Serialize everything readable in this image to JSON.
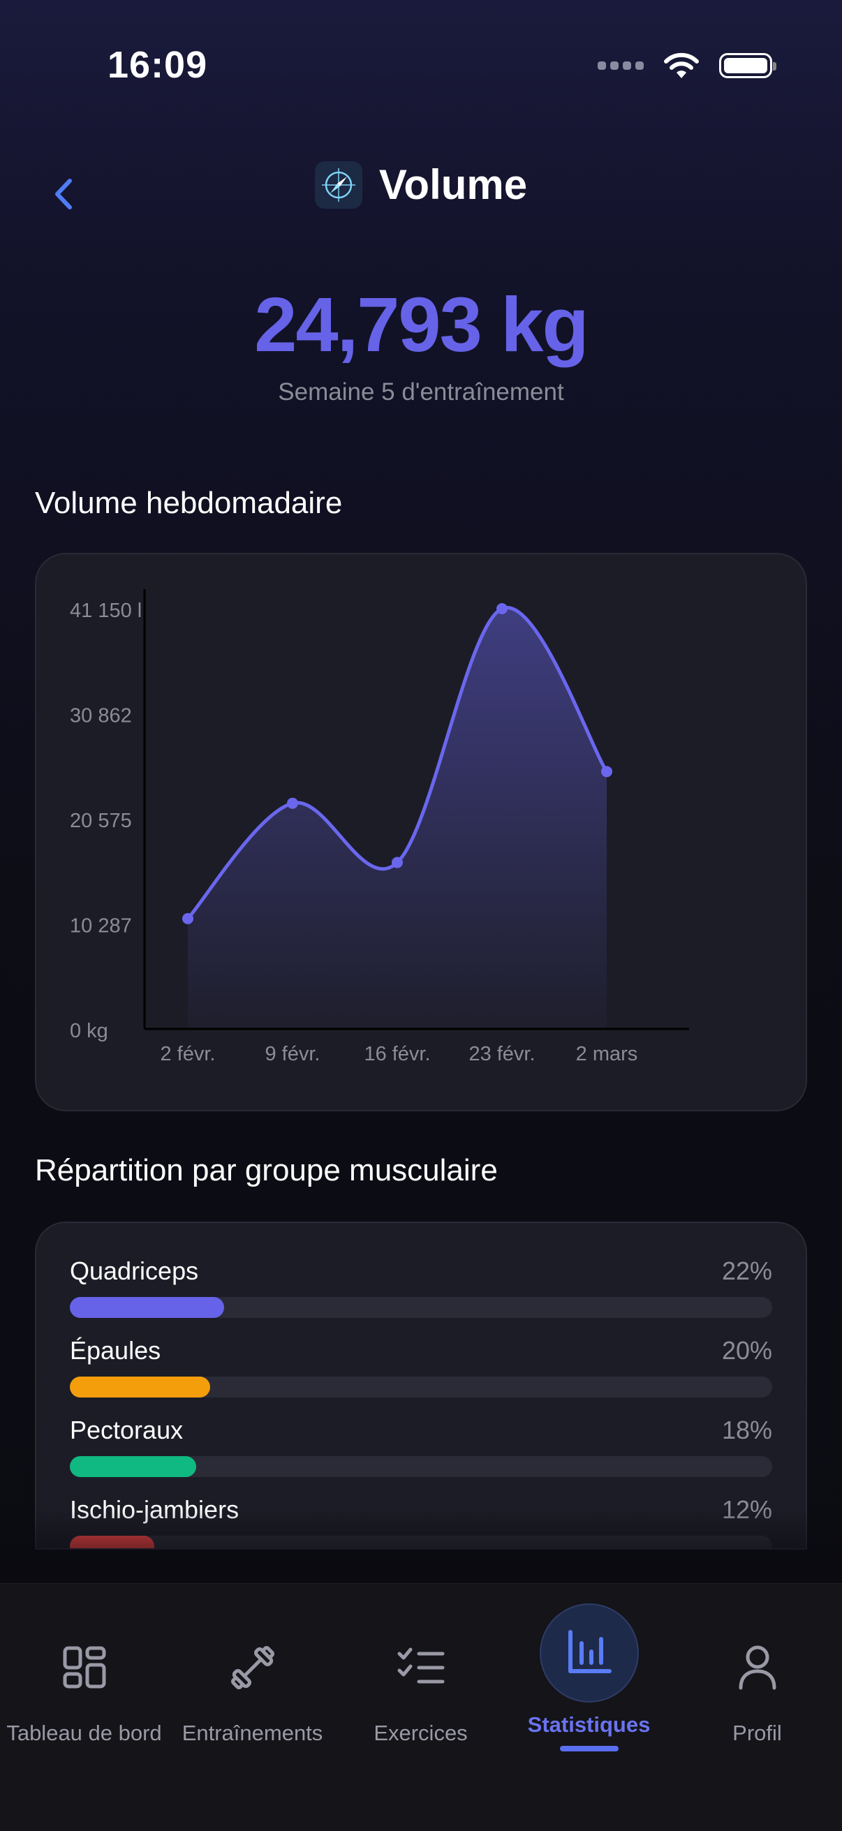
{
  "status": {
    "time": "16:09"
  },
  "header": {
    "title": "Volume",
    "icon": "compass-icon"
  },
  "summary": {
    "value": "24,793 kg",
    "subtitle": "Semaine 5 d'entraînement"
  },
  "weekly": {
    "section_title": "Volume hebdomadaire"
  },
  "chart_data": {
    "type": "area",
    "categories": [
      "2 févr.",
      "9 févr.",
      "16 févr.",
      "23 févr.",
      "2 mars"
    ],
    "values": [
      10800,
      22100,
      16300,
      41150,
      25200
    ],
    "y_ticks": [
      "0 kg",
      "10 287",
      "20 575",
      "30 862",
      "41 150 l"
    ],
    "ylim": [
      0,
      41150
    ],
    "grid": false,
    "color": "#6a67ee"
  },
  "muscles": {
    "section_title": "Répartition par groupe musculaire",
    "items": [
      {
        "label": "Quadriceps",
        "pct": "22%",
        "value": 0.22,
        "color": "#6663e8"
      },
      {
        "label": "Épaules",
        "pct": "20%",
        "value": 0.2,
        "color": "#f59e0b"
      },
      {
        "label": "Pectoraux",
        "pct": "18%",
        "value": 0.18,
        "color": "#10b981"
      },
      {
        "label": "Ischio-jambiers",
        "pct": "12%",
        "value": 0.12,
        "color": "#ef4444"
      }
    ]
  },
  "tabs": [
    {
      "label": "Tableau de bord",
      "icon": "dashboard-icon"
    },
    {
      "label": "Entraînements",
      "icon": "dumbbell-icon"
    },
    {
      "label": "Exercices",
      "icon": "checklist-icon"
    },
    {
      "label": "Statistiques",
      "icon": "bar-chart-icon",
      "active": true
    },
    {
      "label": "Profil",
      "icon": "person-icon"
    }
  ]
}
